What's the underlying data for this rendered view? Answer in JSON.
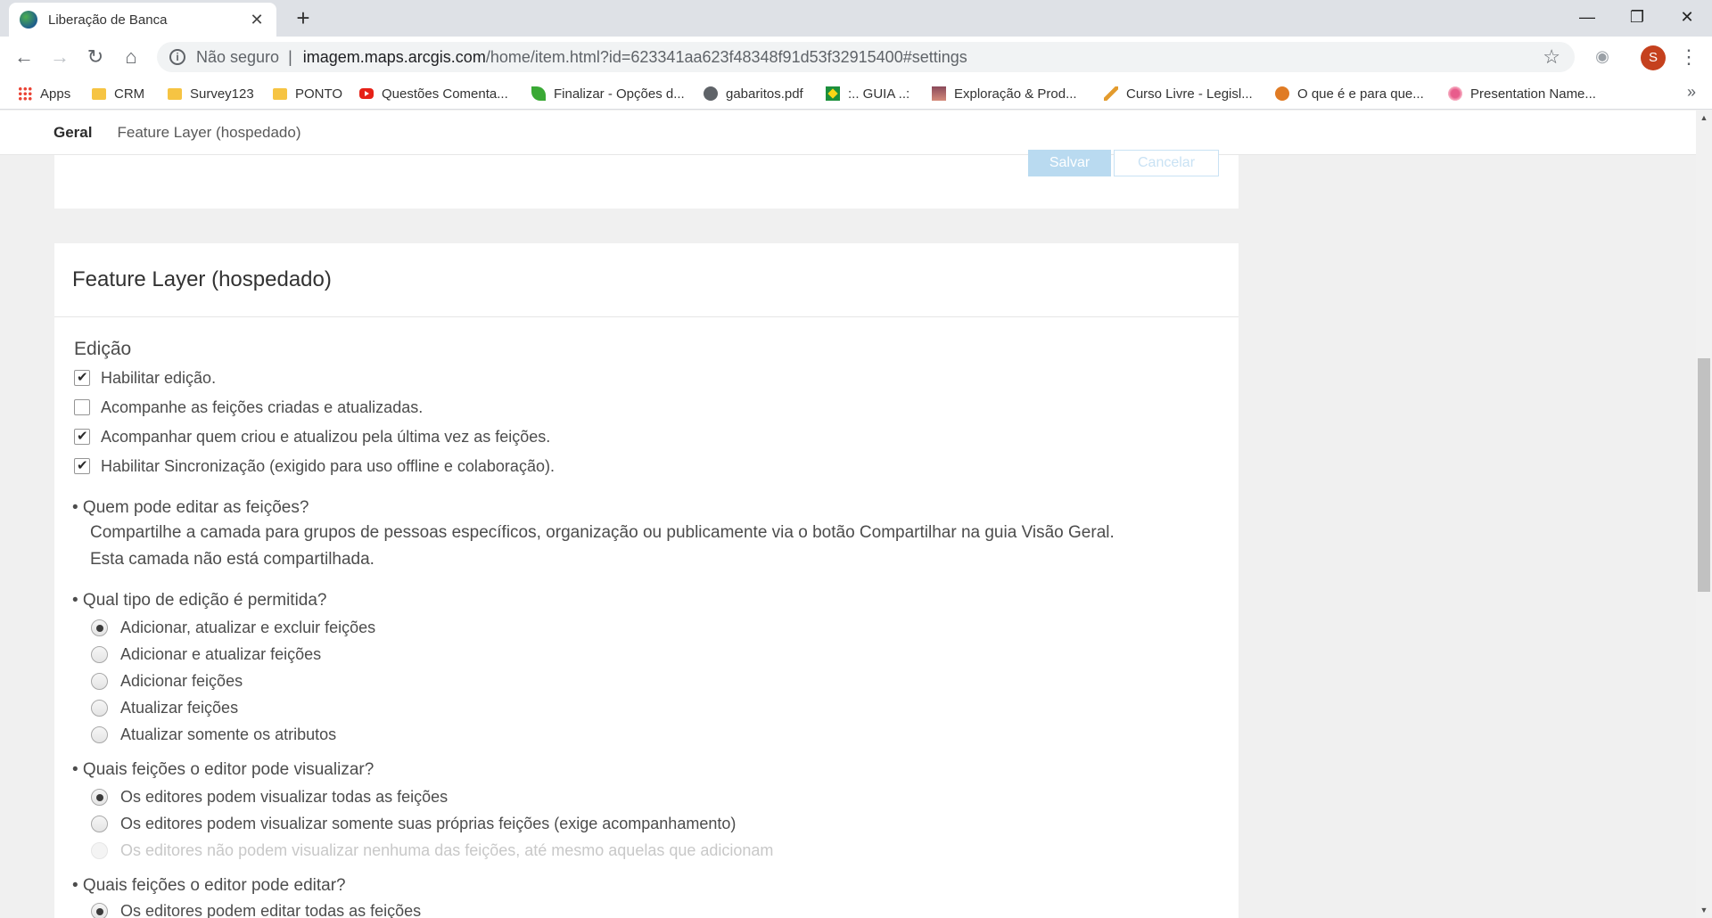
{
  "browser": {
    "tab_title": "Liberação de Banca",
    "tab_close": "✕",
    "new_tab": "+",
    "window_controls": {
      "minimize": "—",
      "restore": "❐",
      "close": "✕"
    },
    "address": {
      "security_label": "Não seguro",
      "separator": "|",
      "host": "imagem.maps.arcgis.com",
      "path": "/home/item.html?id=623341aa623f48348f91d53f32915400#settings"
    },
    "avatar_letter": "S",
    "bookmarks": [
      {
        "label": "Apps",
        "icon": "apps-grid-icon"
      },
      {
        "label": "CRM",
        "icon": "folder-icon"
      },
      {
        "label": "Survey123",
        "icon": "folder-icon"
      },
      {
        "label": "PONTO",
        "icon": "folder-icon"
      },
      {
        "label": "Questões Comenta...",
        "icon": "youtube-icon"
      },
      {
        "label": "Finalizar - Opções d...",
        "icon": "leaf-icon"
      },
      {
        "label": "gabaritos.pdf",
        "icon": "globe-icon"
      },
      {
        "label": ":.. GUIA ..:",
        "icon": "flag-icon"
      },
      {
        "label": "Exploração & Prod...",
        "icon": "photo-icon"
      },
      {
        "label": "Curso Livre - Legisl...",
        "icon": "plane-icon"
      },
      {
        "label": "O que é e para que...",
        "icon": "orange-circle-icon"
      },
      {
        "label": "Presentation Name...",
        "icon": "flower-icon"
      }
    ],
    "bookmarks_more": "»"
  },
  "subnav": {
    "active": "Geral",
    "link": "Feature Layer (hospedado)"
  },
  "top_card": {
    "save_label": "Salvar",
    "cancel_label": "Cancelar"
  },
  "card": {
    "title": "Feature Layer (hospedado)",
    "section": "Edição",
    "checkboxes": [
      {
        "label": "Habilitar edição.",
        "checked": true
      },
      {
        "label": "Acompanhe as feições criadas e atualizadas.",
        "checked": false
      },
      {
        "label": "Acompanhar quem criou e atualizou pela última vez as feições.",
        "checked": true
      },
      {
        "label": "Habilitar Sincronização (exigido para uso offline e colaboração).",
        "checked": true
      }
    ],
    "q1": {
      "question": "• Quem pode editar as feições?",
      "line1": "Compartilhe a camada para grupos de pessoas específicos, organização ou publicamente via o botão Compartilhar na guia Visão Geral.",
      "line2": "Esta camada não está compartilhada."
    },
    "q2": {
      "question": "• Qual tipo de edição é permitida?",
      "options": [
        {
          "label": "Adicionar, atualizar e excluir feições",
          "selected": true
        },
        {
          "label": "Adicionar e atualizar feições",
          "selected": false
        },
        {
          "label": "Adicionar feições",
          "selected": false
        },
        {
          "label": "Atualizar feições",
          "selected": false
        },
        {
          "label": "Atualizar somente os atributos",
          "selected": false
        }
      ]
    },
    "q3": {
      "question": "• Quais feições o editor pode visualizar?",
      "options": [
        {
          "label": "Os editores podem visualizar todas as feições",
          "selected": true,
          "disabled": false
        },
        {
          "label": "Os editores podem visualizar somente suas próprias feições (exige acompanhamento)",
          "selected": false,
          "disabled": false
        },
        {
          "label": "Os editores não podem visualizar nenhuma das feições, até mesmo aquelas que adicionam",
          "selected": false,
          "disabled": true
        }
      ]
    },
    "q4": {
      "question": "• Quais feições o editor pode editar?",
      "options": [
        {
          "label": "Os editores podem editar todas as feições",
          "selected": true
        }
      ]
    }
  }
}
